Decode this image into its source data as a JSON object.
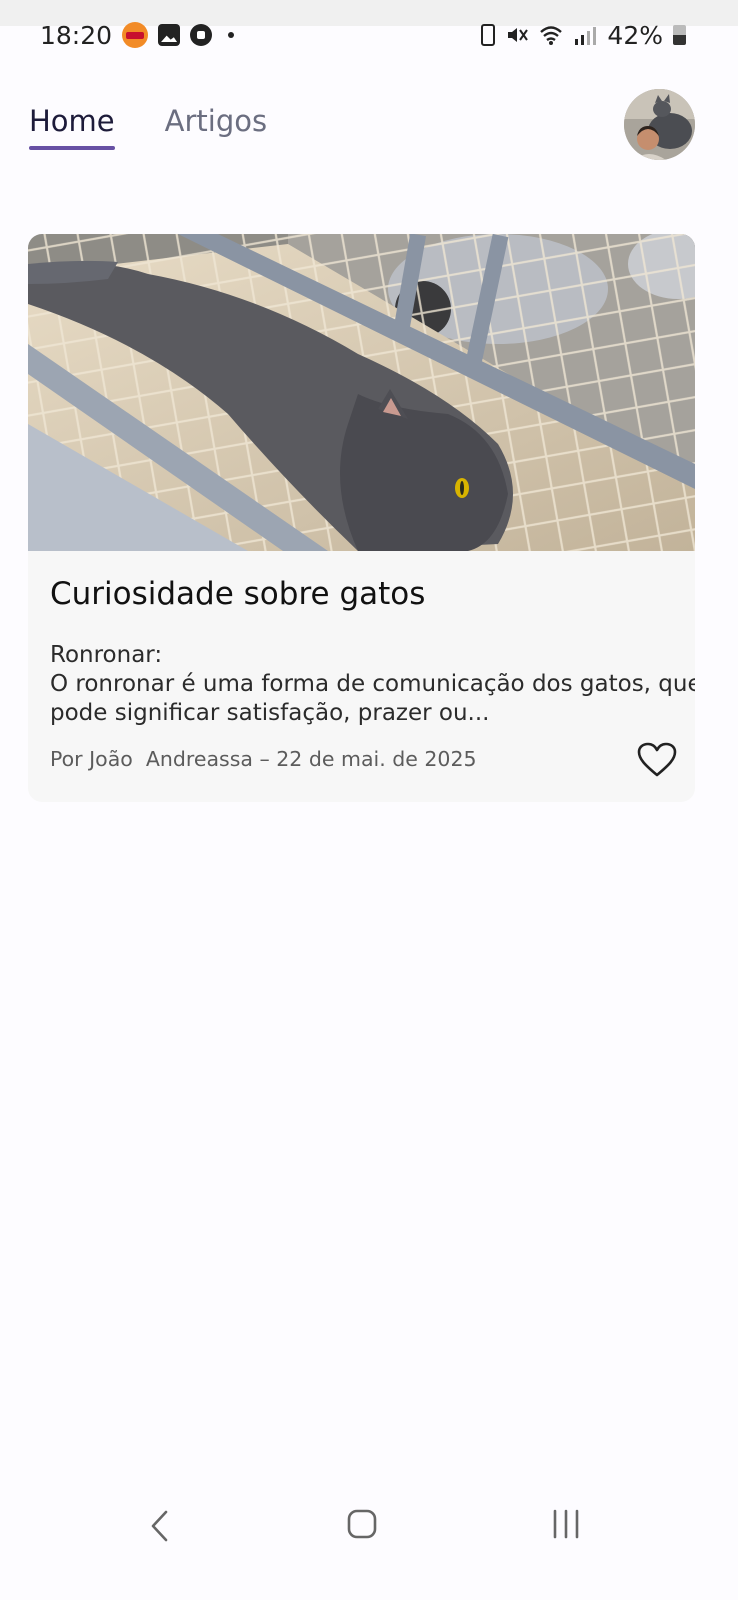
{
  "status_bar": {
    "time": "18:20",
    "battery": "42%",
    "left_icons": [
      "burger-king-icon",
      "gallery-icon",
      "soccer-ball-icon",
      "notification-dot-icon"
    ],
    "right_icons": [
      "battery-saver-icon",
      "mute-icon",
      "wifi-icon",
      "signal-icon",
      "battery-icon"
    ]
  },
  "tabs": [
    {
      "label": "Home",
      "active": true
    },
    {
      "label": "Artigos",
      "active": false
    }
  ],
  "accent_color": "#6750a4",
  "article": {
    "title": "Curiosidade sobre gatos",
    "excerpt_heading": "Ronronar:",
    "excerpt_line1": "O ronronar é uma forma de comunicação dos gatos, que",
    "excerpt_line2": "pode significar satisfação, prazer ou...",
    "meta": "Por João  Andreassa – 22 de mai. de 2025",
    "like_icon": "heart-outline-icon"
  },
  "navigation": {
    "icons": [
      "back-icon",
      "home-icon",
      "recents-icon"
    ]
  }
}
